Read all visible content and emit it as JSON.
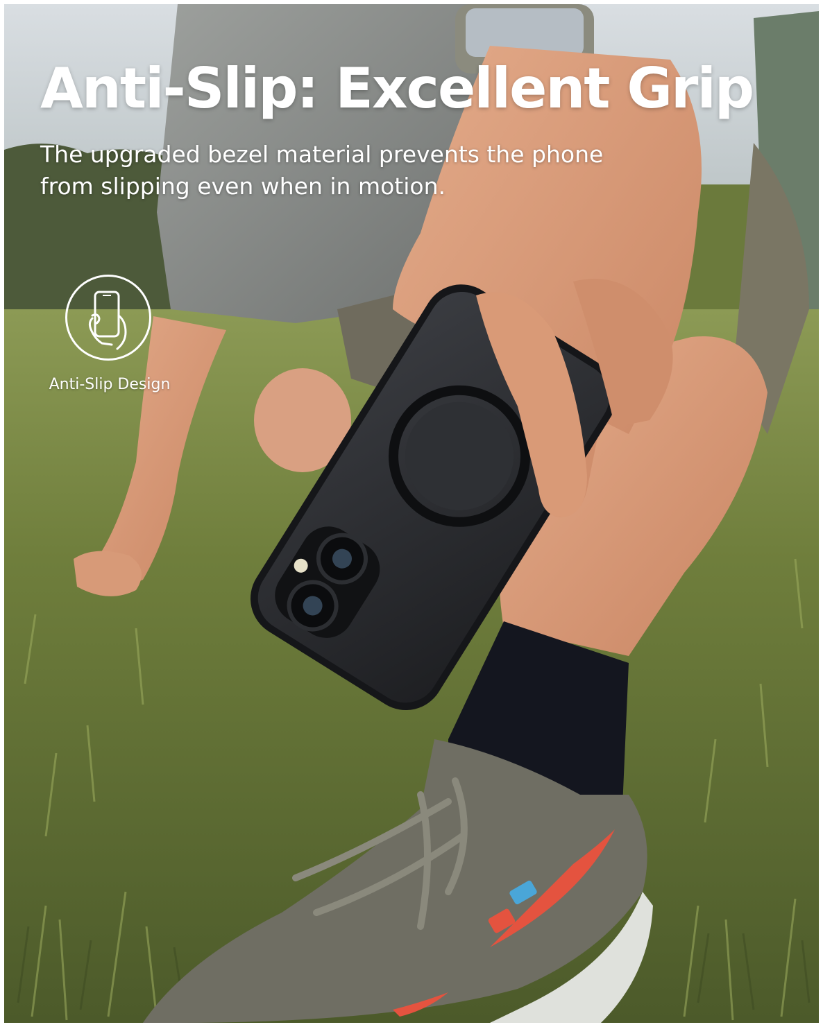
{
  "headline": "Anti-Slip: Excellent Grip",
  "subtitle": "The upgraded bezel material prevents the phone from slipping even when in motion.",
  "feature": {
    "icon": "hand-holding-phone-icon",
    "label": "Anti-Slip Design"
  },
  "colors": {
    "text": "#ffffff",
    "grass": "#6b7a3c",
    "phone_case": "#2a2c30",
    "sock": "#14161f",
    "sneaker": "#6f6e63",
    "swoosh": "#e4533f"
  }
}
